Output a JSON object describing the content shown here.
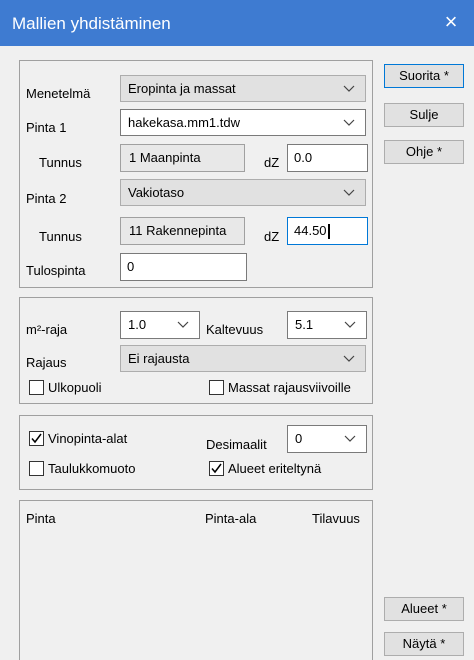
{
  "window": {
    "title": "Mallien yhdistäminen",
    "close_glyph": "×"
  },
  "group1": {
    "menetelma_label": "Menetelmä",
    "menetelma_value": "Eropinta ja massat",
    "pinta1_label": "Pinta 1",
    "pinta1_value": "hakekasa.mm1.tdw",
    "tunnus1_label": "Tunnus",
    "tunnus1_value": "1  Maanpinta",
    "dz1_label": "dZ",
    "dz1_value": "0.0",
    "pinta2_label": "Pinta 2",
    "pinta2_value": "Vakiotaso",
    "tunnus2_label": "Tunnus",
    "tunnus2_value": "11  Rakennepinta",
    "dz2_label": "dZ",
    "dz2_value": "44.50",
    "tulospinta_label": "Tulospinta",
    "tulospinta_value": "0"
  },
  "group2": {
    "m2raja_label": "m²-raja",
    "m2raja_value": "1.0",
    "kaltevuus_label": "Kaltevuus",
    "kaltevuus_value": "5.1",
    "rajaus_label": "Rajaus",
    "rajaus_value": "Ei rajausta",
    "ulkopuoli_label": "Ulkopuoli",
    "ulkopuoli_checked": false,
    "massat_label": "Massat rajausviivoille",
    "massat_checked": false
  },
  "group3": {
    "vinopinta_label": "Vinopinta-alat",
    "vinopinta_checked": true,
    "desimaalit_label": "Desimaalit",
    "desimaalit_value": "0",
    "taulukko_label": "Taulukkomuoto",
    "taulukko_checked": false,
    "alueet_label": "Alueet eriteltynä",
    "alueet_checked": true
  },
  "results": {
    "columns": [
      "Pinta",
      "Pinta-ala",
      "Tilavuus"
    ]
  },
  "buttons": {
    "suorita": "Suorita *",
    "sulje": "Sulje",
    "ohje": "Ohje *",
    "alueet": "Alueet *",
    "nayta": "Näytä *"
  },
  "icons": {
    "close": "close-icon",
    "dropdown": "chevron-down-icon",
    "check": "check-icon"
  },
  "colors": {
    "titlebar": "#3e7bd1",
    "focus": "#0078d7"
  }
}
